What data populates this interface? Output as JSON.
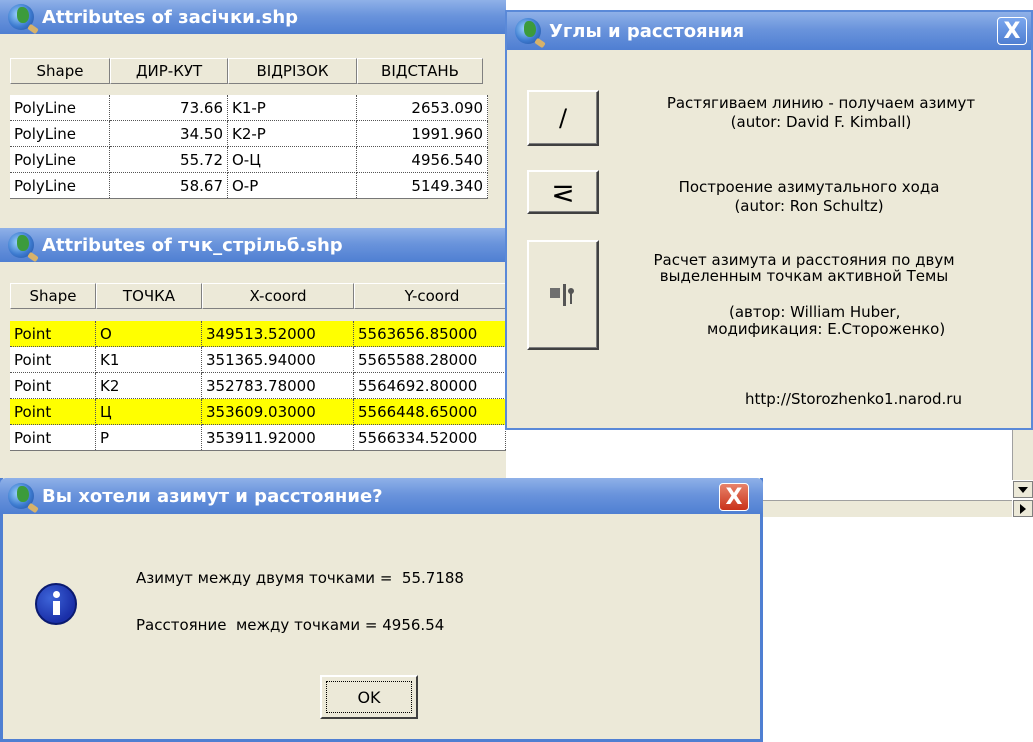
{
  "win1": {
    "title": "Attributes of засічки.shp",
    "columns": [
      "Shape",
      "ДИР-КУТ",
      "ВІДРІЗОК",
      "ВІДСТАНЬ"
    ],
    "rows": [
      [
        "PolyLine",
        "73.66",
        "K1-P",
        "2653.090"
      ],
      [
        "PolyLine",
        "34.50",
        "K2-P",
        "1991.960"
      ],
      [
        "PolyLine",
        "55.72",
        "О-Ц",
        "4956.540"
      ],
      [
        "PolyLine",
        "58.67",
        "О-Р",
        "5149.340"
      ]
    ]
  },
  "win2": {
    "title": "Attributes of тчк_стрільб.shp",
    "columns": [
      "Shape",
      "ТОЧКА",
      "X-coord",
      "Y-coord"
    ],
    "rows": [
      [
        "Point",
        "О",
        "349513.52000",
        "5563656.85000"
      ],
      [
        "Point",
        "K1",
        "351365.94000",
        "5565588.28000"
      ],
      [
        "Point",
        "K2",
        "352783.78000",
        "5564692.80000"
      ],
      [
        "Point",
        "Ц",
        "353609.03000",
        "5566448.65000"
      ],
      [
        "Point",
        "Р",
        "353911.92000",
        "5566334.52000"
      ]
    ],
    "highlight_color": "#ffff00"
  },
  "win3": {
    "title": "Углы и расстояния",
    "close": "X",
    "tools": [
      {
        "icon": "slash-icon",
        "glyph": "/",
        "line1": "Растягиваем линию - получаем азимут",
        "line2": "(autor: David F. Kimball)"
      },
      {
        "icon": "traverse-icon",
        "glyph": "⋜",
        "line1": "Построение азимутального хода",
        "line2": "(autor: Ron Schultz)"
      },
      {
        "icon": "points-icon",
        "glyph": "",
        "line1": "Расчет азимута и расстояния по двум",
        "line2": "выделенным точкам активной Темы",
        "line3": "(автор: William Huber,",
        "line4": "модификация: Е.Стороженко)"
      }
    ],
    "url": "http://Storozhenko1.narod.ru"
  },
  "dialog": {
    "title": "Вы хотели азимут и расстояние?",
    "close": "X",
    "azimuth_text": "Азимут между двумя точками =  55.7188",
    "distance_text": "Расстояние  между точками = 4956.54",
    "ok_label": "OK"
  },
  "colors": {
    "titlebar": "#5a89d8",
    "dialog_bg": "#ece9d8",
    "highlight": "#ffff00",
    "close_red": "#d9442a"
  }
}
